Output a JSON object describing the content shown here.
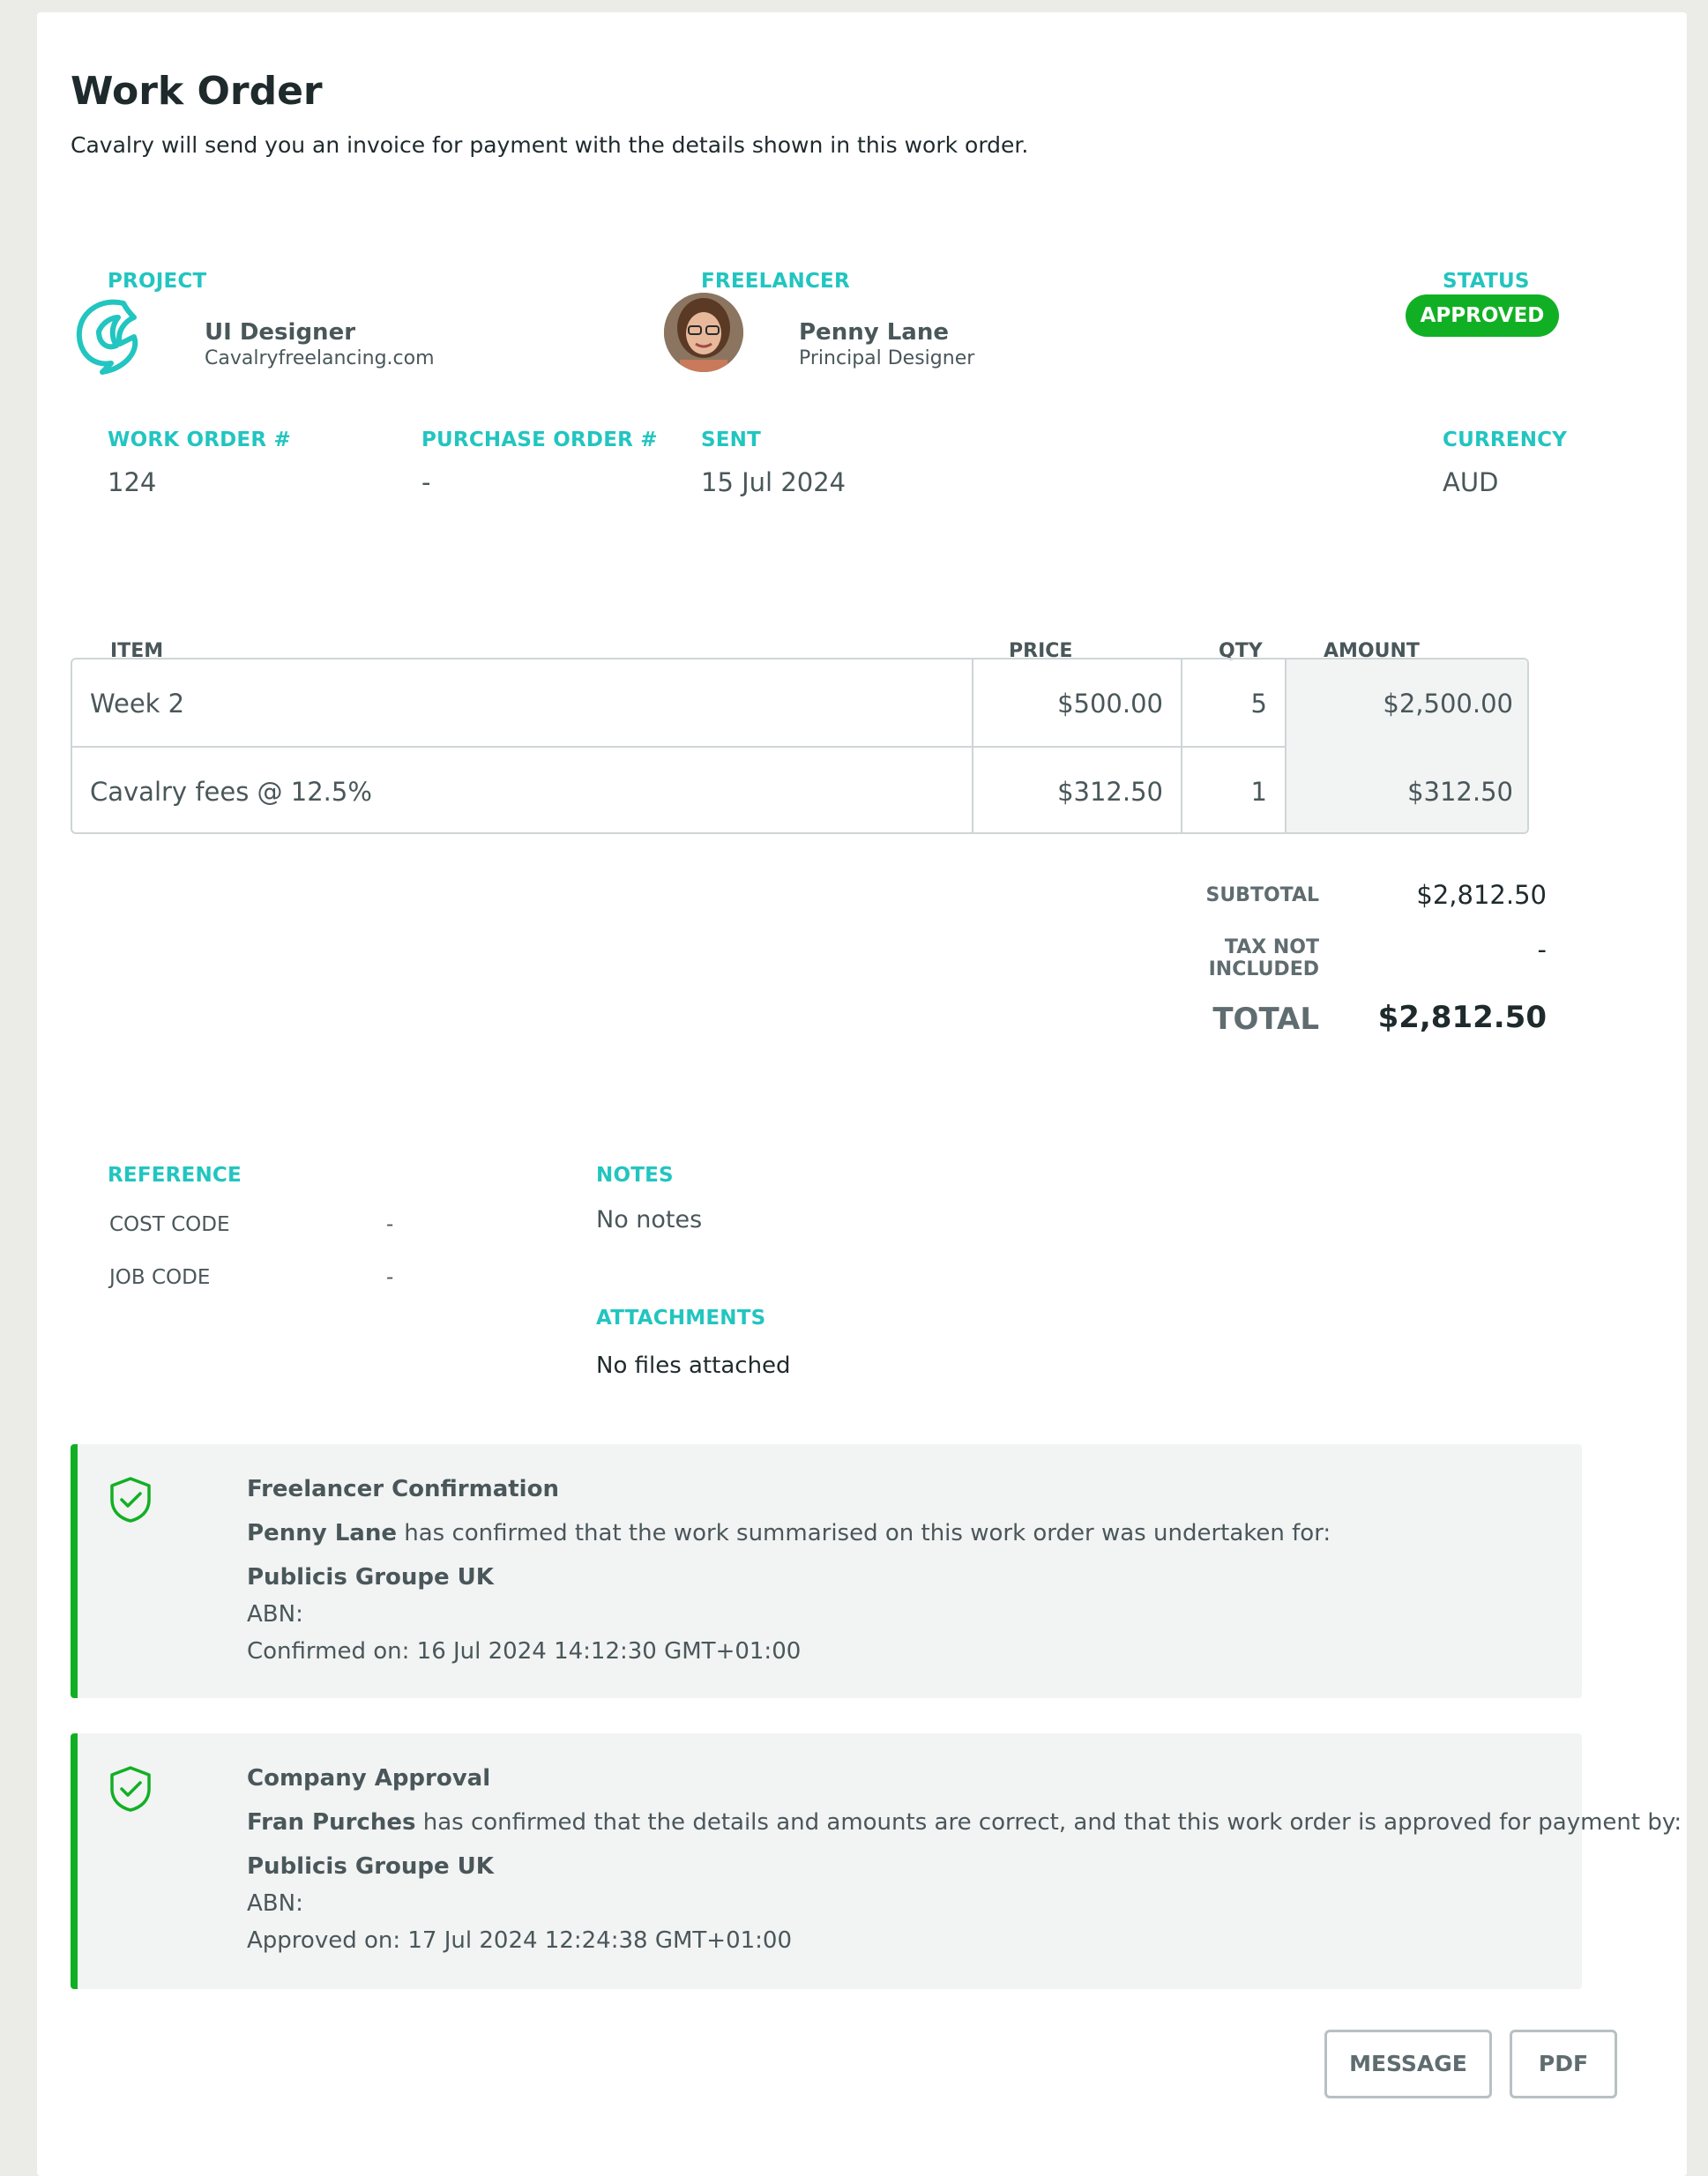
{
  "header": {
    "title": "Work Order",
    "subtitle": "Cavalry will send you an invoice for payment with the details shown in this work order."
  },
  "project": {
    "label": "PROJECT",
    "name": "UI Designer",
    "site": "Cavalryfreelancing.com",
    "logo_icon": "cavalry-horse-logo-icon"
  },
  "freelancer": {
    "label": "FREELANCER",
    "name": "Penny Lane",
    "role": "Principal Designer"
  },
  "status": {
    "label": "STATUS",
    "value": "APPROVED",
    "color": "#11b024"
  },
  "meta": {
    "work_order_label": "WORK ORDER #",
    "work_order_value": "124",
    "purchase_order_label": "PURCHASE ORDER #",
    "purchase_order_value": "-",
    "sent_label": "SENT",
    "sent_value": "15 Jul 2024",
    "currency_label": "CURRENCY",
    "currency_value": "AUD"
  },
  "table": {
    "headers": {
      "item": "ITEM",
      "price": "PRICE",
      "qty": "QTY",
      "amount": "AMOUNT"
    },
    "rows": [
      {
        "item": "Week 2",
        "price": "$500.00",
        "qty": "5",
        "amount": "$2,500.00"
      },
      {
        "item": "Cavalry fees @ 12.5%",
        "price": "$312.50",
        "qty": "1",
        "amount": "$312.50"
      }
    ]
  },
  "totals": {
    "subtotal_label": "SUBTOTAL",
    "subtotal_value": "$2,812.50",
    "tax_label_line1": "TAX NOT",
    "tax_label_line2": "INCLUDED",
    "tax_value": "-",
    "total_label": "TOTAL",
    "total_value": "$2,812.50"
  },
  "reference": {
    "label": "REFERENCE",
    "cost_code_label": "COST CODE",
    "cost_code_value": "-",
    "job_code_label": "JOB CODE",
    "job_code_value": "-"
  },
  "notes": {
    "label": "NOTES",
    "value": "No notes"
  },
  "attachments": {
    "label": "ATTACHMENTS",
    "value": "No files attached"
  },
  "freelancer_confirmation": {
    "title": "Freelancer Confirmation",
    "person": "Penny Lane",
    "text": " has confirmed that the work summarised on this work order was undertaken for:",
    "company": "Publicis Groupe UK",
    "abn": "ABN:",
    "date": "Confirmed on: 16 Jul 2024 14:12:30 GMT+01:00",
    "icon": "shield-check-icon"
  },
  "company_approval": {
    "title": "Company Approval",
    "person": "Fran Purches",
    "text": " has confirmed that the details and amounts are correct, and that this work order is approved for payment by:",
    "company": "Publicis Groupe UK",
    "abn": "ABN:",
    "date": "Approved on: 17 Jul 2024 12:24:38 GMT+01:00",
    "icon": "shield-check-icon"
  },
  "actions": {
    "message_label": "MESSAGE",
    "pdf_label": "PDF"
  },
  "colors": {
    "accent": "#22c5c0",
    "approved": "#11b024",
    "text": "#4a575a"
  }
}
